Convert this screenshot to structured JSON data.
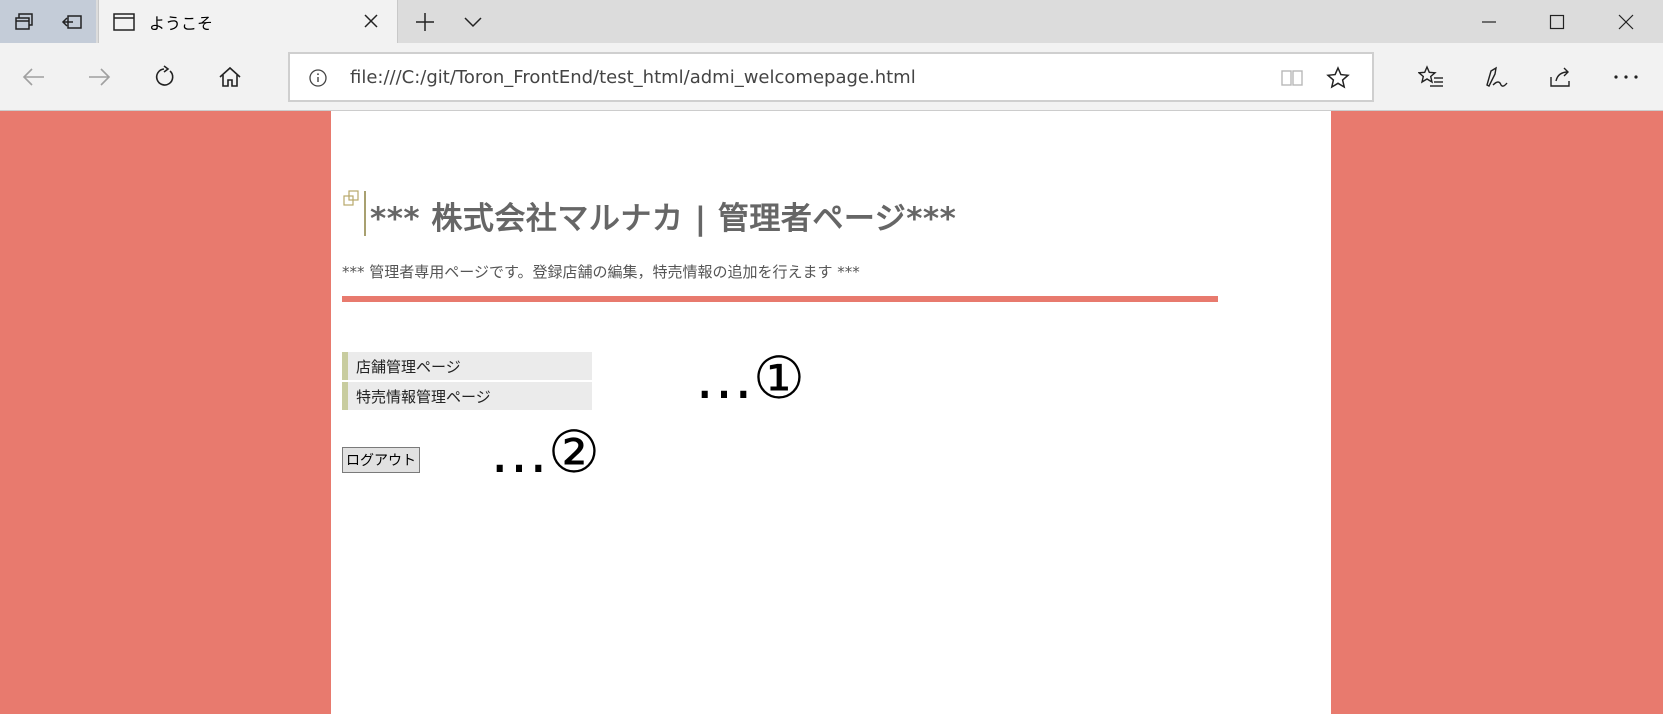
{
  "browser": {
    "tab_title": "ようこそ",
    "address": "file:///C:/git/Toron_FrontEnd/test_html/admi_welcomepage.html"
  },
  "page": {
    "title": "*** 株式会社マルナカ | 管理者ページ***",
    "subtitle": "*** 管理者専用ページです。登録店舗の編集，特売情報の追加を行えます ***",
    "menu": [
      {
        "label": "店舗管理ページ"
      },
      {
        "label": "特売情報管理ページ"
      }
    ],
    "logout_label": "ログアウト",
    "annotation_1": "…①",
    "annotation_2": "…②"
  },
  "colors": {
    "page_background": "#e87a6e",
    "accent_bar": "#e87a6e",
    "menu_border": "#c8cc9f",
    "title_text": "#666666"
  }
}
